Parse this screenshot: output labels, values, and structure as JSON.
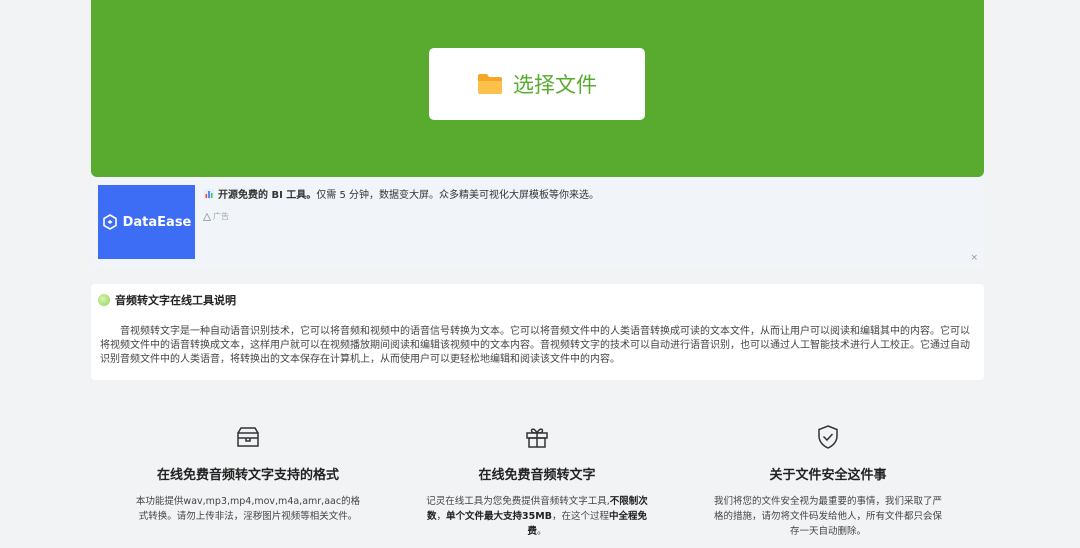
{
  "upload": {
    "button_label": "选择文件"
  },
  "ad": {
    "logo_text": "DataEase",
    "headline_bold": "开源免费的 BI 工具。",
    "headline_rest": "仅需 5 分钟，数据变大屏。众多精美可视化大屏模板等你来选。",
    "tag": "广告",
    "close": "×"
  },
  "description": {
    "title": "音频转文字在线工具说明",
    "body": "音视频转文字是一种自动语音识别技术，它可以将音频和视频中的语音信号转换为文本。它可以将音频文件中的人类语音转换成可读的文本文件，从而让用户可以阅读和编辑其中的内容。它可以将视频文件中的语音转换成文本，这样用户就可以在视频播放期间阅读和编辑该视频中的文本内容。音视频转文字的技术可以自动进行语音识别，也可以通过人工智能技术进行人工校正。它通过自动识别音频文件中的人类语音，将转换出的文本保存在计算机上，从而使用户可以更轻松地编辑和阅读该文件中的内容。"
  },
  "features": [
    {
      "icon": "box-icon",
      "title": "在线免费音频转文字支持的格式",
      "desc_1": "本功能提供wav,mp3,mp4,mov,m4a,amr,aac的格式转换。请勿上传非法，淫秽图片视频等相关文件。"
    },
    {
      "icon": "gift-icon",
      "title": "在线免费音频转文字",
      "desc_1": "记灵在线工具为您免费提供音频转文字工具,",
      "desc_bold_1": "不限制次数",
      "desc_2": "，",
      "desc_bold_2": "单个文件最大支持35MB",
      "desc_3": "，在这个过程",
      "desc_bold_3": "中全程免费",
      "desc_4": "。"
    },
    {
      "icon": "shield-check-icon",
      "title": "关于文件安全这件事",
      "desc_1": "我们将您的文件安全视为最重要的事情，我们采取了严格的措施，请勿将文件码发给他人，所有文件都只会保存一天自动删除。"
    }
  ],
  "colors": {
    "accent_green": "#58ab2e",
    "ad_blue": "#3d6df5"
  }
}
